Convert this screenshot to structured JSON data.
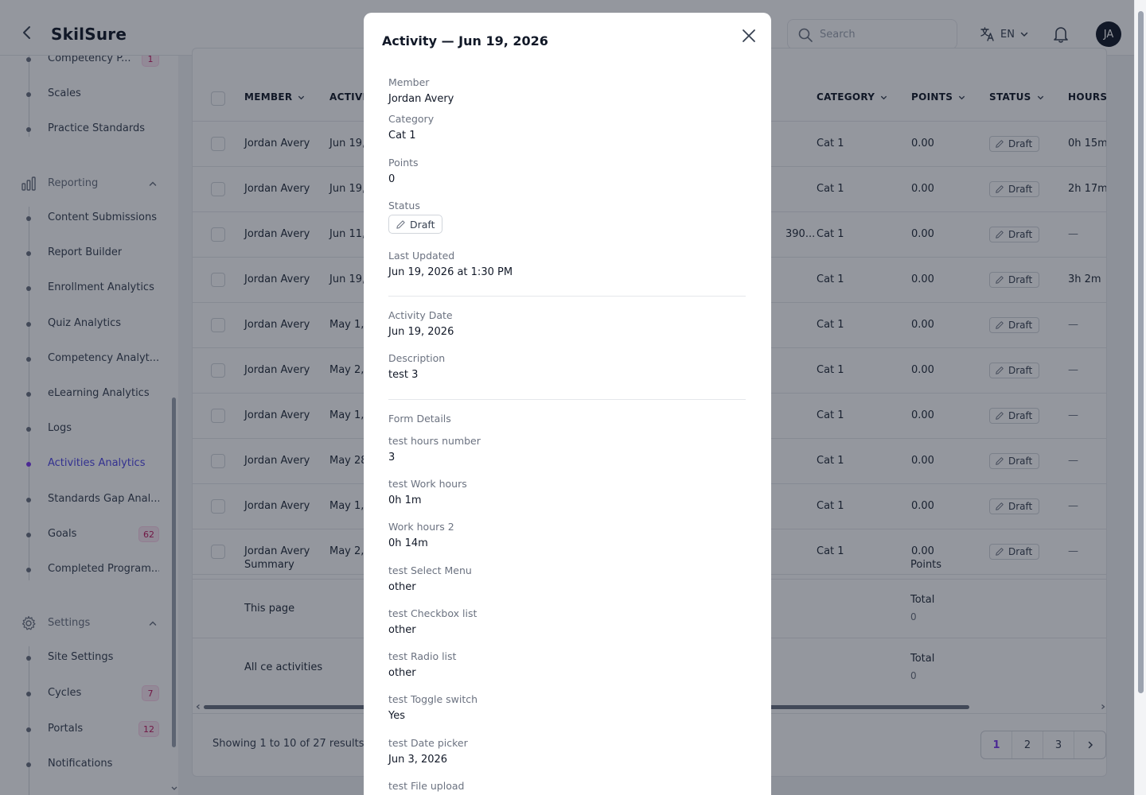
{
  "app": {
    "brand": "SkilSure"
  },
  "topbar": {
    "search_placeholder": "Search",
    "language": "EN",
    "avatar_initials": "JA"
  },
  "sidebar": {
    "competency_group": [
      {
        "label": "Competency P...",
        "badge": "1"
      },
      {
        "label": "Scales"
      },
      {
        "label": "Practice Standards"
      }
    ],
    "reporting": {
      "label": "Reporting",
      "icon": "bar-chart-icon",
      "items": [
        {
          "label": "Content Submissions"
        },
        {
          "label": "Report Builder"
        },
        {
          "label": "Enrollment Analytics"
        },
        {
          "label": "Quiz Analytics"
        },
        {
          "label": "Competency Analyt..."
        },
        {
          "label": "eLearning Analytics"
        },
        {
          "label": "Logs"
        },
        {
          "label": "Activities Analytics",
          "active": true
        },
        {
          "label": "Standards Gap Anal..."
        },
        {
          "label": "Goals",
          "badge": "62"
        },
        {
          "label": "Completed Program..."
        }
      ]
    },
    "settings": {
      "label": "Settings",
      "icon": "gear-icon",
      "items": [
        {
          "label": "Site Settings"
        },
        {
          "label": "Cycles",
          "badge": "7"
        },
        {
          "label": "Portals",
          "badge": "12"
        },
        {
          "label": "Notifications"
        }
      ]
    }
  },
  "table": {
    "headers": {
      "member": "MEMBER",
      "activity": "ACTIVI",
      "category": "CATEGORY",
      "points": "POINTS",
      "status": "STATUS",
      "hours": "HOURS"
    },
    "rows": [
      {
        "member": "Jordan Avery",
        "activity": "Jun 19,",
        "extra": "",
        "category": "Cat 1",
        "points": "0.00",
        "status": "Draft",
        "hours": "0h 15m"
      },
      {
        "member": "Jordan Avery",
        "activity": "Jun 19,",
        "extra": "",
        "category": "Cat 1",
        "points": "0.00",
        "status": "Draft",
        "hours": "2h 17m"
      },
      {
        "member": "Jordan Avery",
        "activity": "Jun 11,",
        "extra": "390...",
        "category": "Cat 1",
        "points": "0.00",
        "status": "Draft",
        "hours": "—"
      },
      {
        "member": "Jordan Avery",
        "activity": "Jun 19,",
        "extra": "",
        "category": "Cat 1",
        "points": "0.00",
        "status": "Draft",
        "hours": "3h 2m"
      },
      {
        "member": "Jordan Avery",
        "activity": "May 1,",
        "extra": "",
        "category": "Cat 1",
        "points": "0.00",
        "status": "Draft",
        "hours": "—"
      },
      {
        "member": "Jordan Avery",
        "activity": "May 2,",
        "extra": "",
        "category": "Cat 1",
        "points": "0.00",
        "status": "Draft",
        "hours": "—"
      },
      {
        "member": "Jordan Avery",
        "activity": "May 1,",
        "extra": "",
        "category": "Cat 1",
        "points": "0.00",
        "status": "Draft",
        "hours": "—"
      },
      {
        "member": "Jordan Avery",
        "activity": "May 28",
        "extra": "",
        "category": "Cat 1",
        "points": "0.00",
        "status": "Draft",
        "hours": "—"
      },
      {
        "member": "Jordan Avery",
        "activity": "May 1,",
        "extra": "",
        "category": "Cat 1",
        "points": "0.00",
        "status": "Draft",
        "hours": "—"
      },
      {
        "member": "Jordan Avery",
        "activity": "May 2,",
        "extra": "",
        "category": "Cat 1",
        "points": "0.00",
        "status": "Draft",
        "hours": "—"
      }
    ],
    "summary": {
      "label": "Summary",
      "points_header": "Points",
      "this_page": {
        "label": "This page",
        "total_label": "Total",
        "total_value": "0"
      },
      "all": {
        "label": "All ce activities",
        "total_label": "Total",
        "total_value": "0"
      }
    },
    "footer": {
      "showing": "Showing 1 to 10 of 27 results",
      "pages": [
        "1",
        "2",
        "3"
      ],
      "current_page": "1"
    }
  },
  "modal": {
    "title": "Activity — Jun 19, 2026",
    "member": {
      "label": "Member",
      "value": "Jordan Avery"
    },
    "category": {
      "label": "Category",
      "value": "Cat 1"
    },
    "points": {
      "label": "Points",
      "value": "0"
    },
    "status": {
      "label": "Status",
      "value": "Draft"
    },
    "last_updated": {
      "label": "Last Updated",
      "value": "Jun 19, 2026 at 1:30 PM"
    },
    "activity_date": {
      "label": "Activity Date",
      "value": "Jun 19, 2026"
    },
    "description": {
      "label": "Description",
      "value": "test 3"
    },
    "form_details_heading": "Form Details",
    "form_fields": [
      {
        "label": "test hours number",
        "value": "3"
      },
      {
        "label": "test Work hours",
        "value": "0h 1m"
      },
      {
        "label": "Work hours 2",
        "value": "0h 14m"
      },
      {
        "label": "test Select Menu",
        "value": "other"
      },
      {
        "label": "test Checkbox list",
        "value": "other"
      },
      {
        "label": "test Radio list",
        "value": "other"
      },
      {
        "label": "test Toggle switch",
        "value": "Yes"
      },
      {
        "label": "test Date picker",
        "value": "Jun 3, 2026"
      },
      {
        "label": "test File upload",
        "value": ""
      }
    ]
  },
  "colors": {
    "accent": "#7c3aed",
    "active_link": "#4f46e5",
    "badge_bg": "#fce7f3",
    "badge_text": "#be185d"
  }
}
